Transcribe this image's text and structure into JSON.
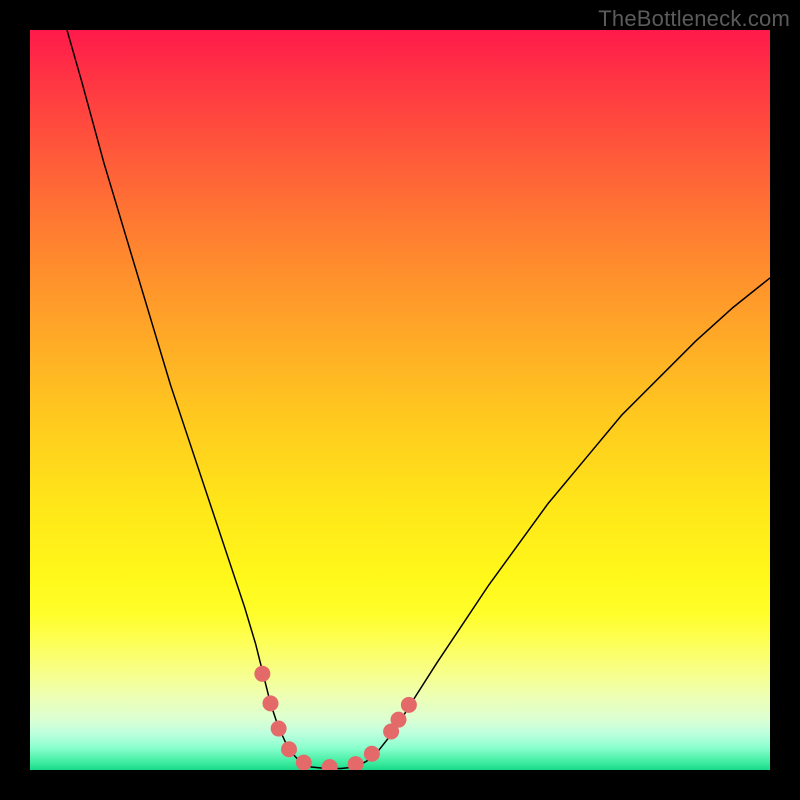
{
  "watermark": {
    "text": "TheBottleneck.com"
  },
  "chart_data": {
    "type": "line",
    "title": "",
    "xlabel": "",
    "ylabel": "",
    "xlim": [
      0,
      100
    ],
    "ylim": [
      0,
      100
    ],
    "grid": false,
    "curve": {
      "name": "bottleneck-curve",
      "color": "#000000",
      "width": 1.5,
      "points": [
        {
          "x": 5.0,
          "y": 100.0
        },
        {
          "x": 7.0,
          "y": 93.0
        },
        {
          "x": 10.0,
          "y": 82.0
        },
        {
          "x": 13.0,
          "y": 72.0
        },
        {
          "x": 16.0,
          "y": 62.0
        },
        {
          "x": 19.0,
          "y": 52.0
        },
        {
          "x": 22.0,
          "y": 43.0
        },
        {
          "x": 25.0,
          "y": 34.0
        },
        {
          "x": 27.0,
          "y": 28.0
        },
        {
          "x": 29.0,
          "y": 22.0
        },
        {
          "x": 30.5,
          "y": 17.0
        },
        {
          "x": 31.5,
          "y": 13.0
        },
        {
          "x": 32.5,
          "y": 9.0
        },
        {
          "x": 33.5,
          "y": 6.0
        },
        {
          "x": 34.5,
          "y": 3.8
        },
        {
          "x": 35.5,
          "y": 2.2
        },
        {
          "x": 36.5,
          "y": 1.1
        },
        {
          "x": 38.0,
          "y": 0.4
        },
        {
          "x": 40.0,
          "y": 0.2
        },
        {
          "x": 42.0,
          "y": 0.2
        },
        {
          "x": 44.0,
          "y": 0.4
        },
        {
          "x": 45.5,
          "y": 1.2
        },
        {
          "x": 47.0,
          "y": 2.5
        },
        {
          "x": 48.5,
          "y": 4.4
        },
        {
          "x": 50.0,
          "y": 6.6
        },
        {
          "x": 52.0,
          "y": 9.8
        },
        {
          "x": 55.0,
          "y": 14.5
        },
        {
          "x": 58.0,
          "y": 19.0
        },
        {
          "x": 62.0,
          "y": 25.0
        },
        {
          "x": 66.0,
          "y": 30.5
        },
        {
          "x": 70.0,
          "y": 36.0
        },
        {
          "x": 75.0,
          "y": 42.0
        },
        {
          "x": 80.0,
          "y": 48.0
        },
        {
          "x": 85.0,
          "y": 53.0
        },
        {
          "x": 90.0,
          "y": 58.0
        },
        {
          "x": 95.0,
          "y": 62.5
        },
        {
          "x": 100.0,
          "y": 66.5
        }
      ]
    },
    "markers": {
      "name": "highlight-points",
      "color": "#e46a6a",
      "radius": 8,
      "points": [
        {
          "x": 31.4,
          "y": 13.0
        },
        {
          "x": 32.5,
          "y": 9.0
        },
        {
          "x": 33.6,
          "y": 5.6
        },
        {
          "x": 35.0,
          "y": 2.8
        },
        {
          "x": 37.0,
          "y": 1.0
        },
        {
          "x": 40.5,
          "y": 0.4
        },
        {
          "x": 44.0,
          "y": 0.8
        },
        {
          "x": 46.2,
          "y": 2.2
        },
        {
          "x": 48.8,
          "y": 5.2
        },
        {
          "x": 49.8,
          "y": 6.8
        },
        {
          "x": 51.2,
          "y": 8.8
        }
      ]
    },
    "background_gradient": {
      "direction": "top-to-bottom",
      "stops": [
        {
          "pos": 0.0,
          "color": "#ff1a4b"
        },
        {
          "pos": 0.5,
          "color": "#ffc81f"
        },
        {
          "pos": 0.8,
          "color": "#fdff5a"
        },
        {
          "pos": 1.0,
          "color": "#19d989"
        }
      ]
    }
  }
}
